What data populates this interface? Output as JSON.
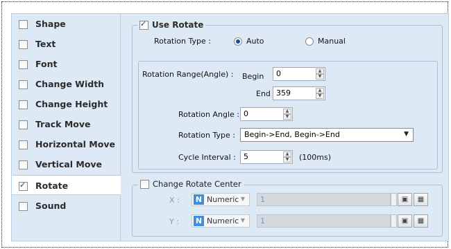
{
  "sidebar": {
    "items": [
      {
        "label": "Shape",
        "checked": false
      },
      {
        "label": "Text",
        "checked": false
      },
      {
        "label": "Font",
        "checked": false
      },
      {
        "label": "Change Width",
        "checked": false
      },
      {
        "label": "Change Height",
        "checked": false
      },
      {
        "label": "Track Move",
        "checked": false
      },
      {
        "label": "Horizontal Move",
        "checked": false
      },
      {
        "label": "Vertical Move",
        "checked": false
      },
      {
        "label": "Rotate",
        "checked": true
      },
      {
        "label": "Sound",
        "checked": false
      }
    ],
    "selected": "Rotate"
  },
  "rotate": {
    "use_rotate_label": "Use Rotate",
    "use_rotate_checked": true,
    "rotation_type_label": "Rotation Type :",
    "radio_auto": "Auto",
    "radio_manual": "Manual",
    "selected_mode": "Auto",
    "range_label": "Rotation Range(Angle) :",
    "begin_label": "Begin",
    "begin_value": "0",
    "end_label": "End",
    "end_value": "359",
    "angle_label": "Rotation Angle :",
    "angle_value": "0",
    "type_label": "Rotation Type :",
    "type_value": "Begin->End, Begin->End",
    "cycle_label": "Cycle Interval :",
    "cycle_value": "5",
    "cycle_unit": "(100ms)"
  },
  "center": {
    "title": "Change Rotate Center",
    "checked": false,
    "x_label": "X :",
    "y_label": "Y :",
    "badge": "N",
    "type_text": "Numeric",
    "x_value": "1",
    "y_value": "1"
  },
  "colors": {
    "panel_bg": "#dde9f5",
    "border": "#b9cde3",
    "radio_dot": "#1a4aa8",
    "numeric_badge": "#3f8fe0"
  }
}
